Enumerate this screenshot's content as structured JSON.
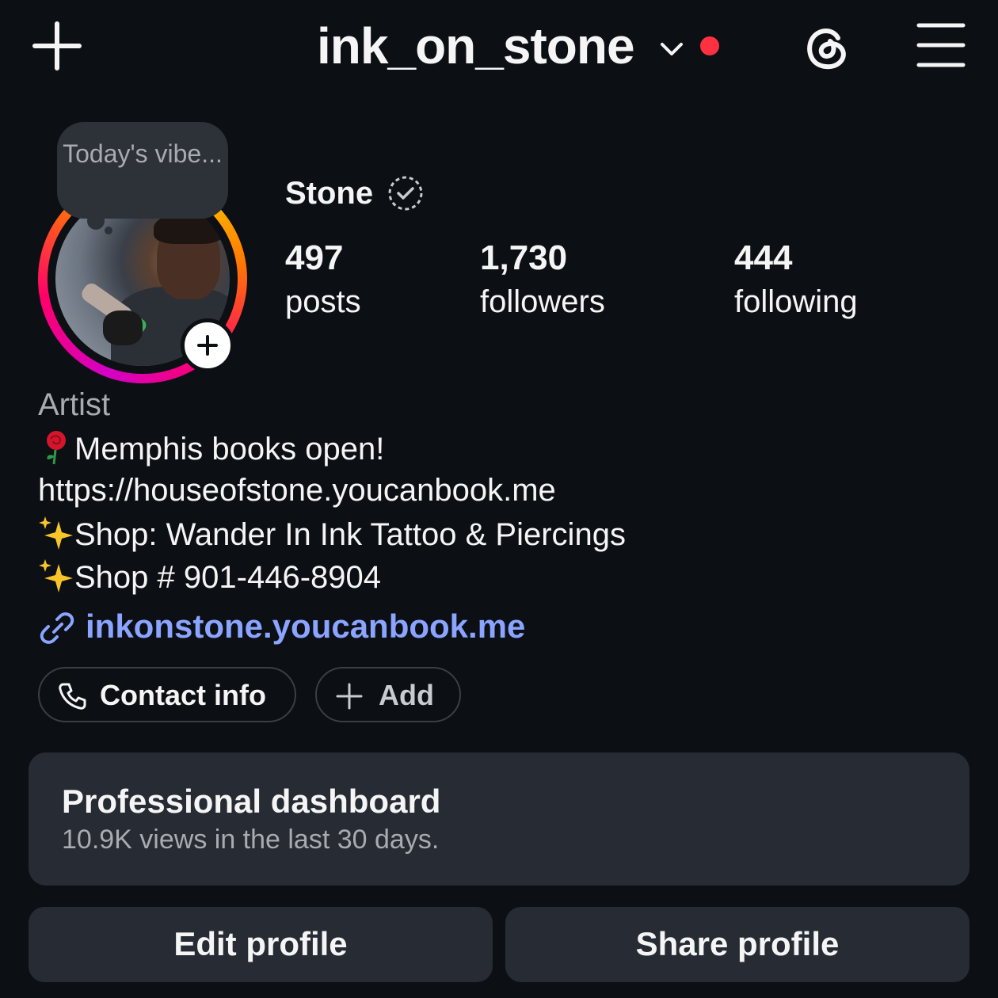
{
  "header": {
    "username": "ink_on_stone",
    "chevron_icon": "chevron-down-icon",
    "notification_color": "#ff3040"
  },
  "note": {
    "text": "Today's vibe..."
  },
  "profile": {
    "display_name": "Stone",
    "stats": [
      {
        "value": "497",
        "label": "posts"
      },
      {
        "value": "1,730",
        "label": "followers"
      },
      {
        "value": "444",
        "label": "following"
      }
    ]
  },
  "bio": {
    "category": "Artist",
    "line1": "Memphis books open!",
    "line2": "https://houseofstone.youcanbook.me",
    "line3": "Shop: Wander In Ink Tattoo & Piercings",
    "line4": "Shop # 901-446-8904",
    "link": "inkonstone.youcanbook.me",
    "link_color": "#8aa4ff"
  },
  "chips": {
    "contact": "Contact info",
    "add": "Add"
  },
  "dashboard": {
    "title": "Professional dashboard",
    "subtitle": "10.9K views in the last 30 days."
  },
  "actions": {
    "edit": "Edit profile",
    "share": "Share profile"
  }
}
